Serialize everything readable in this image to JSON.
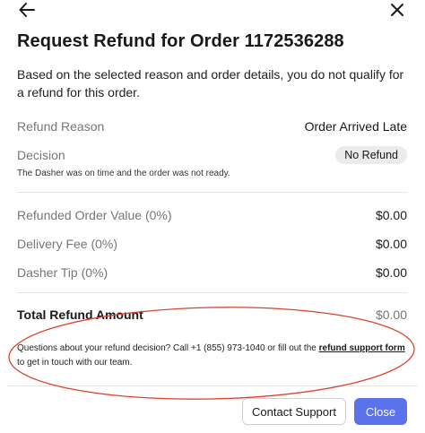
{
  "modal": {
    "title": "Request Refund for Order 1172536288",
    "intro": "Based on the selected reason and order details, you do not qualify for a refund for this order."
  },
  "refund_reason": {
    "label": "Refund Reason",
    "value": "Order Arrived Late"
  },
  "decision": {
    "label": "Decision",
    "value": "No Refund",
    "note": "The Dasher was on time and the order was not ready."
  },
  "line_items": [
    {
      "label": "Refunded Order Value (0%)",
      "value": "$0.00"
    },
    {
      "label": "Delivery Fee (0%)",
      "value": "$0.00"
    },
    {
      "label": "Dasher Tip (0%)",
      "value": "$0.00"
    }
  ],
  "total": {
    "label": "Total Refund Amount",
    "value": "$0.00"
  },
  "footer": {
    "text_before": "Questions about your refund decision? Call +1 (855) 973-1040 or fill out the ",
    "link": "refund support form",
    "text_after": " to get in touch with our team."
  },
  "actions": {
    "contact_label": "Contact Support",
    "close_label": "Close"
  },
  "colors": {
    "primary": "#5a73ea",
    "badge_bg": "#ebebeb",
    "annotation": "#d9432f"
  },
  "icons": {
    "back": "arrow-left-icon",
    "close": "close-icon"
  }
}
